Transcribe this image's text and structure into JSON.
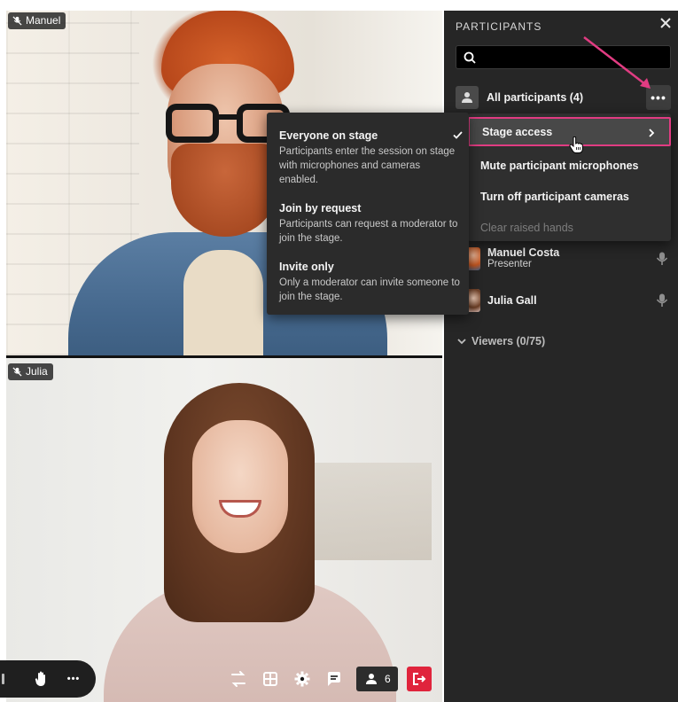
{
  "tiles": {
    "manuel": {
      "name": "Manuel"
    },
    "julia": {
      "name": "Julia"
    }
  },
  "panel": {
    "title": "PARTICIPANTS",
    "close_icon": "close-icon",
    "search": {
      "value": "",
      "placeholder": ""
    },
    "all_participants_label": "All participants (4)",
    "more_label": "•••",
    "participants": [
      {
        "name": "Manuel Costa",
        "role": "Presenter"
      },
      {
        "name": "Julia Gall",
        "role": ""
      }
    ],
    "viewers_label": "Viewers (0/75)"
  },
  "more_menu": {
    "items": [
      {
        "label": "Stage access"
      },
      {
        "label": "Mute participant microphones"
      },
      {
        "label": "Turn off participant cameras"
      },
      {
        "label": "Clear raised hands"
      }
    ]
  },
  "stage_access_menu": {
    "options": [
      {
        "title": "Everyone on stage",
        "description": "Participants enter the session on stage with microphones and cameras enabled.",
        "selected": true
      },
      {
        "title": "Join by request",
        "description": "Participants can request a moderator to join the stage."
      },
      {
        "title": "Invite only",
        "description": "Only a moderator can invite someone to join the stage."
      }
    ]
  },
  "controls": {
    "more_label": "•••",
    "participants_count": "6"
  },
  "colors": {
    "highlight": "#e13c82",
    "leave": "#e0243c",
    "panel_bg": "#262626"
  }
}
